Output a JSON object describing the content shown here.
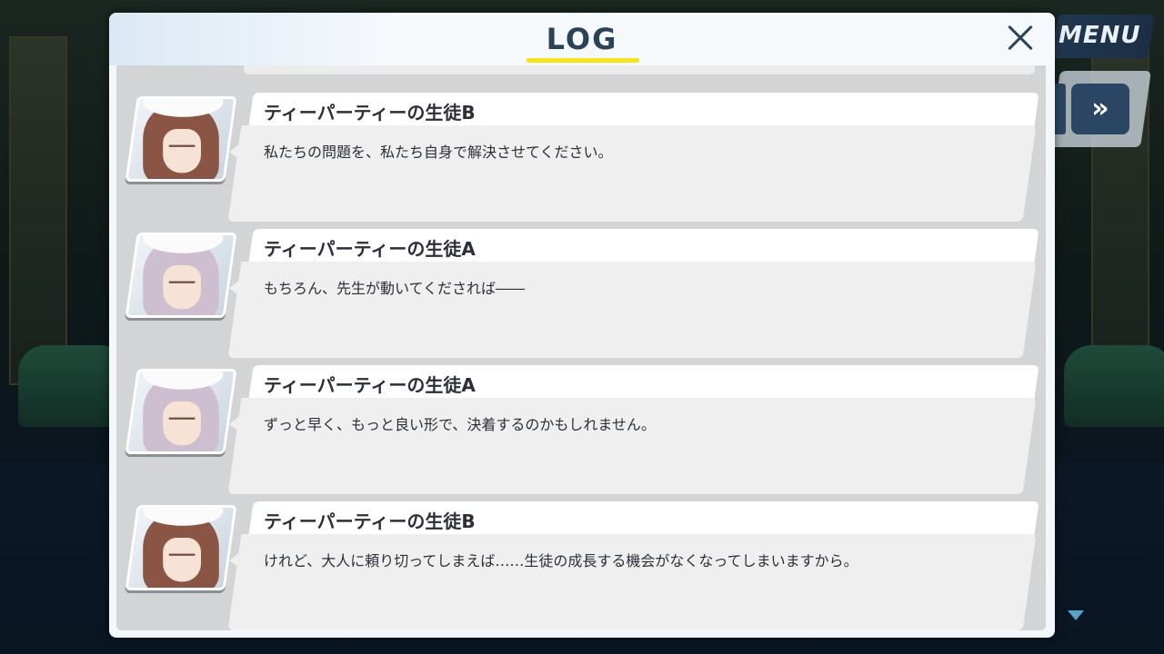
{
  "hud": {
    "menu_label": "MENU",
    "fast_forward_label": "»"
  },
  "panel": {
    "title": "LOG",
    "accent_color": "#f5e31d"
  },
  "entries": [
    {
      "speaker": "ティーパーティーの生徒B",
      "text": "私たちの問題を、私たち自身で解決させてください。",
      "portrait": "student-b-portrait"
    },
    {
      "speaker": "ティーパーティーの生徒A",
      "text": "もちろん、先生が動いてくだされば――",
      "portrait": "student-a-portrait"
    },
    {
      "speaker": "ティーパーティーの生徒A",
      "text": "ずっと早く、もっと良い形で、決着するのかもしれません。",
      "portrait": "student-a-portrait"
    },
    {
      "speaker": "ティーパーティーの生徒B",
      "text": "けれど、大人に頼り切ってしまえば……生徒の成長する機会がなくなってしまいますから。",
      "portrait": "student-b-portrait"
    }
  ]
}
